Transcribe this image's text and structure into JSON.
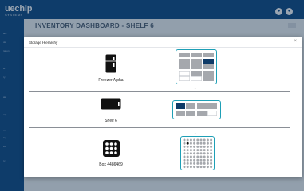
{
  "app": {
    "logo_main": "uechip",
    "logo_sub": "SYSTEMS",
    "page_title": "INVENTORY DASHBOARD - SHELF 6",
    "sidebar_items": [
      "ard",
      "ole",
      "ration",
      "le",
      "ry",
      "ate",
      "ary",
      "er",
      "ing",
      "ion",
      "ry"
    ]
  },
  "modal": {
    "title": "Storage Hierarchy",
    "close_icon": "×",
    "arrow_icon": "↓",
    "levels": [
      {
        "label": "Freezer Alpha",
        "icon": "freezer-icon"
      },
      {
        "label": "Shelf 6",
        "icon": "shelf-icon"
      },
      {
        "label": "Box 4486469",
        "icon": "box-grid-icon"
      }
    ]
  },
  "colors": {
    "accent_border": "#1e9fb6",
    "highlight": "#0e3a67",
    "occupied": "#a5a8ad",
    "empty": "#ffffff"
  }
}
